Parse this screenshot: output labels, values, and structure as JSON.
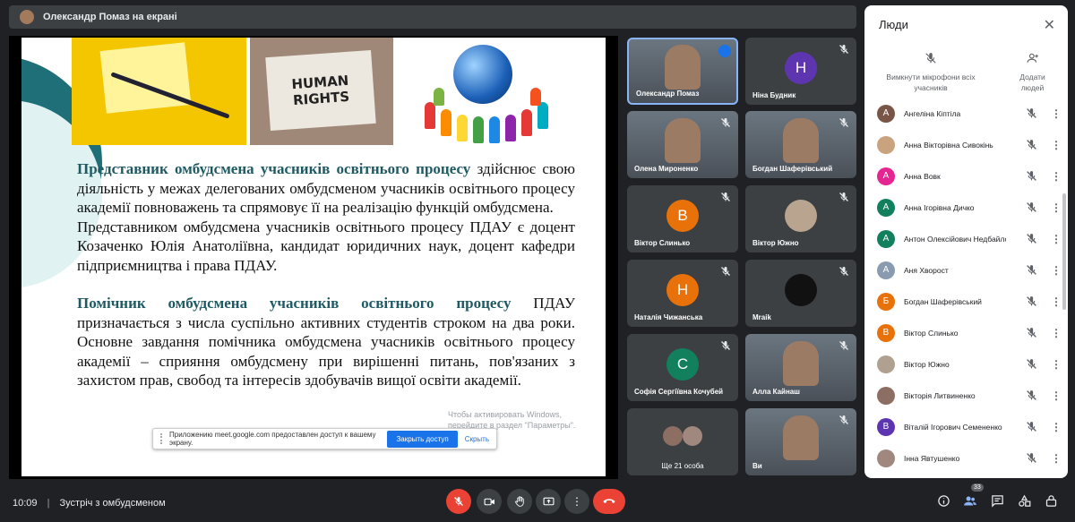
{
  "topbar": {
    "presenter_text": "Олександр Помаз на екрані"
  },
  "slide": {
    "badge_text_line1": "HUMAN",
    "badge_text_line2": "RIGHTS",
    "para1_highlight": "Представник омбудсмена учасників освітнього процесу",
    "para1_rest": " здійснює свою діяльність у межах делегованих омбудсменом учасників освітнього процесу академії повноважень та спрямовує її на реалізацію функцій омбудсмена.",
    "para2": "Представником омбудсмена учасників освітнього процесу ПДАУ є доцент Козаченко Юлія Анатоліївна, кандидат юридичних наук, доцент кафедри підприємництва і права ПДАУ.",
    "para3_highlight": "Помічник омбудсмена учасників освітнього процесу",
    "para3_rest": " ПДАУ призначається з числа суспільно активних студентів строком на два роки. Основне завдання помічника омбудсмена учасників освітнього процесу академії – сприяння омбудсмену при вирішенні питань, пов'язаних з захистом прав, свобод та інтересів здобувачів вищої освіти академії.",
    "watermark_line1": "Чтобы активировать Windows,",
    "watermark_line2": "перейдите в раздел \"Параметры\"."
  },
  "sharebar": {
    "message": "Приложению meet.google.com предоставлен доступ к вашему экрану.",
    "allow_button": "Закрыть доступ",
    "hide_link": "Скрыть"
  },
  "tiles": [
    {
      "name": "Олександр Помаз",
      "kind": "video",
      "speaking": true
    },
    {
      "name": "Ніна Будник",
      "kind": "avatar",
      "letter": "Н",
      "color": "#5e35b1"
    },
    {
      "name": "Олена Мироненко",
      "kind": "video"
    },
    {
      "name": "Богдан Шаферівський",
      "kind": "video"
    },
    {
      "name": "Віктор Слинько",
      "kind": "avatar",
      "letter": "В",
      "color": "#e8710a"
    },
    {
      "name": "Віктор Южно",
      "kind": "photo"
    },
    {
      "name": "Наталія Чижанська",
      "kind": "avatar",
      "letter": "Н",
      "color": "#e8710a"
    },
    {
      "name": "Mraik",
      "kind": "photo"
    },
    {
      "name": "Софія Сергіївна Кочубей",
      "kind": "avatar",
      "letter": "С",
      "color": "#12805c"
    },
    {
      "name": "Алла Кайнаш",
      "kind": "video"
    },
    {
      "name": "Ще 21 особа",
      "kind": "group"
    },
    {
      "name": "Ви",
      "kind": "video"
    }
  ],
  "panel": {
    "title": "Люди",
    "mute_all": "Вимкнути мікрофони всіх учасників",
    "add_people": "Додати людей",
    "people": [
      {
        "name": "Ангеліна Кіптіла",
        "letter": "А",
        "color": "#795548"
      },
      {
        "name": "Анна Вікторівна Сивокінь",
        "letter": "",
        "color": "#c9a27e"
      },
      {
        "name": "Анна Вовк",
        "letter": "А",
        "color": "#e52592"
      },
      {
        "name": "Анна Ігорівна Дичко",
        "letter": "А",
        "color": "#12805c"
      },
      {
        "name": "Антон Олексійович Недбайло",
        "letter": "А",
        "color": "#12805c"
      },
      {
        "name": "Аня Хворост",
        "letter": "А",
        "color": "#8a9bb0"
      },
      {
        "name": "Богдан Шаферівський",
        "letter": "Б",
        "color": "#e8710a"
      },
      {
        "name": "Віктор Слинько",
        "letter": "В",
        "color": "#e8710a"
      },
      {
        "name": "Віктор Южно",
        "letter": "",
        "color": "#b0a090"
      },
      {
        "name": "Вікторія Литвиненко",
        "letter": "",
        "color": "#8d6e63"
      },
      {
        "name": "Віталій Ігорович Семененко",
        "letter": "В",
        "color": "#5e35b1"
      },
      {
        "name": "Інна Явтушенко",
        "letter": "",
        "color": "#a1887f"
      }
    ]
  },
  "bottom": {
    "time": "10:09",
    "separator": "|",
    "meeting_title": "Зустріч з омбудсменом",
    "participants_count": "33"
  }
}
